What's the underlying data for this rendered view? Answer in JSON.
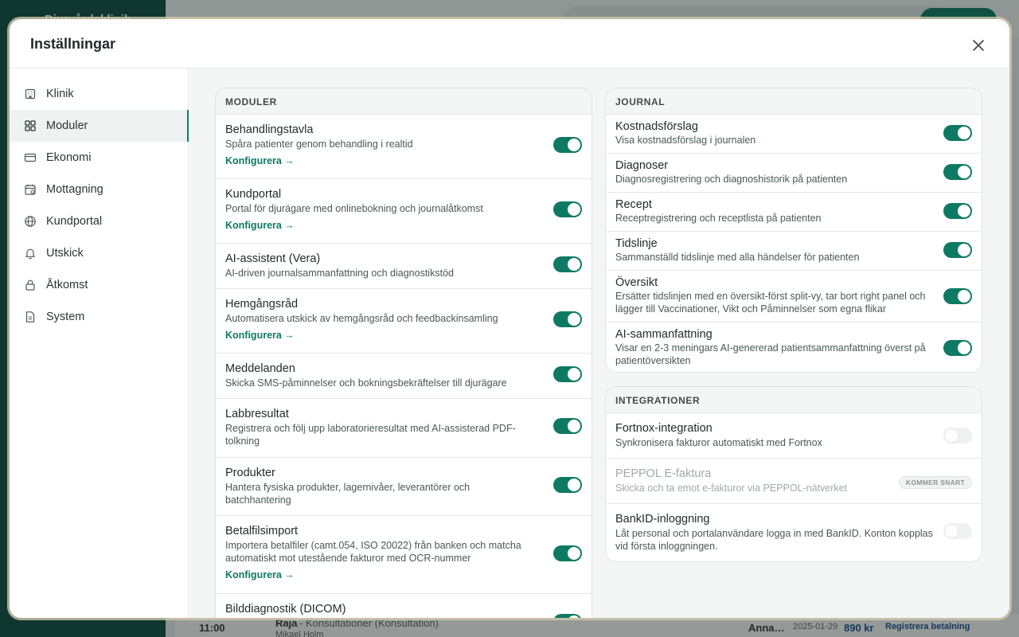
{
  "background": {
    "brand": "Djurvårdsklinik",
    "bottom_time": "11:00",
    "bottom_patient": "Raja",
    "bottom_visit": "- Konsultationer (Konsultation)",
    "bottom_vet": "Mikael Holm",
    "bottom_owner": "Anna…",
    "bottom_date": "2025-01-29",
    "bottom_amount": "890 kr",
    "bottom_action": "Registrera betalning"
  },
  "modal": {
    "title": "Inställningar"
  },
  "nav": [
    {
      "label": "Klinik",
      "icon": "building-icon"
    },
    {
      "label": "Moduler",
      "icon": "grid-icon"
    },
    {
      "label": "Ekonomi",
      "icon": "card-icon"
    },
    {
      "label": "Mottagning",
      "icon": "calendar-icon"
    },
    {
      "label": "Kundportal",
      "icon": "globe-icon"
    },
    {
      "label": "Utskick",
      "icon": "bell-icon"
    },
    {
      "label": "Åtkomst",
      "icon": "lock-icon"
    },
    {
      "label": "System",
      "icon": "document-icon"
    }
  ],
  "moduler": {
    "heading": "MODULER",
    "configure": "Konfigurera →",
    "items": [
      {
        "title": "Behandlingstavla",
        "desc": "Spåra patienter genom behandling i realtid",
        "on": true
      },
      {
        "title": "Kundportal",
        "desc": "Portal för djurägare med onlinebokning och journalåtkomst",
        "on": true
      },
      {
        "title": "AI-assistent (Vera)",
        "desc": "AI-driven journalsammanfattning och diagnostikstöd",
        "on": true
      },
      {
        "title": "Hemgångsråd",
        "desc": "Automatisera utskick av hemgångsråd och feedbackinsamling",
        "on": true
      },
      {
        "title": "Meddelanden",
        "desc": "Skicka SMS-påminnelser och bokningsbekräftelser till djurägare",
        "on": true
      },
      {
        "title": "Labbresultat",
        "desc": "Registrera och följ upp laboratorieresultat med AI-assisterad PDF-tolkning",
        "on": true
      },
      {
        "title": "Produkter",
        "desc": "Hantera fysiska produkter, lagernivåer, leverantörer och batchhantering",
        "on": true
      },
      {
        "title": "Betalfilsimport",
        "desc": "Importera betalfiler (camt.054, ISO 20022) från banken och matcha automatiskt mot utestående fakturor med OCR-nummer",
        "on": true
      },
      {
        "title": "Bilddiagnostik (DICOM)",
        "desc": "",
        "on": true
      }
    ]
  },
  "journal": {
    "heading": "JOURNAL",
    "items": [
      {
        "title": "Kostnadsförslag",
        "desc": "Visa kostnadsförslag i journalen",
        "on": true
      },
      {
        "title": "Diagnoser",
        "desc": "Diagnosregistrering och diagnoshistorik på patienten",
        "on": true
      },
      {
        "title": "Recept",
        "desc": "Receptregistrering och receptlista på patienten",
        "on": true
      },
      {
        "title": "Tidslinje",
        "desc": "Sammanställd tidslinje med alla händelser för patienten",
        "on": true
      },
      {
        "title": "Översikt",
        "desc": "Ersätter tidslinjen med en översikt-först split-vy, tar bort right panel och lägger till Vaccinationer, Vikt och Påminnelser som egna flikar",
        "on": true
      },
      {
        "title": "AI-sammanfattning",
        "desc": "Visar en 2-3 meningars AI-genererad patientsammanfattning överst på patientöversikten",
        "on": true
      }
    ]
  },
  "integrationer": {
    "heading": "INTEGRATIONER",
    "items": [
      {
        "title": "Fortnox-integration",
        "desc": "Synkronisera fakturor automatiskt med Fortnox",
        "on": false
      },
      {
        "title": "PEPPOL E-faktura",
        "desc": "Skicka och ta emot e-fakturor via PEPPOL-nätverket",
        "badge": "KOMMER SNART"
      },
      {
        "title": "BankID-inloggning",
        "desc": "Låt personal och portalanvändare logga in med BankID. Konton kopplas vid första inloggningen.",
        "on": false
      }
    ]
  }
}
